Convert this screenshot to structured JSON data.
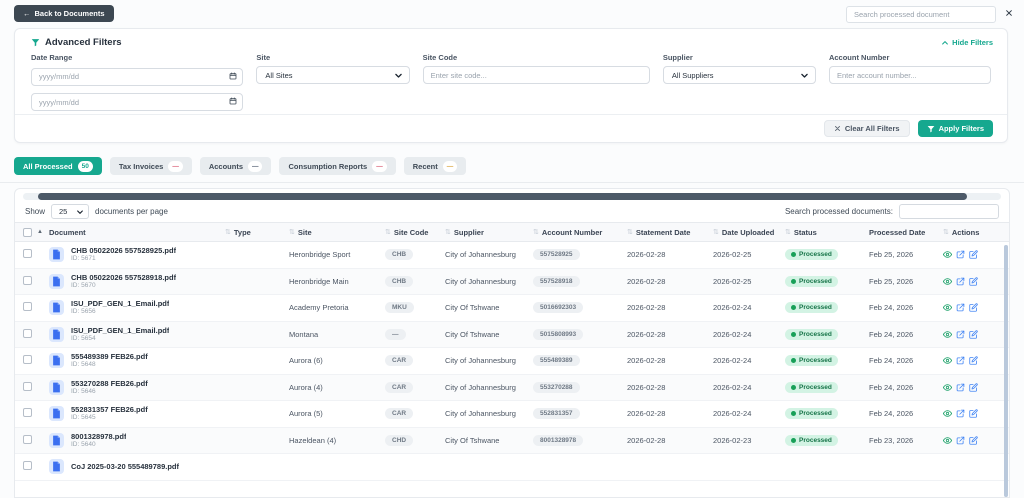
{
  "colors": {
    "accent": "#16a88f",
    "status_green": "#18a058",
    "back_button_bg": "#3d4852"
  },
  "icons": {
    "sort": "⇅",
    "sort_asc": "▲",
    "back_arrow": "←"
  },
  "topbar": {
    "back_label": "Back to Documents",
    "search_placeholder": "Search processed document"
  },
  "filters": {
    "title": "Advanced Filters",
    "hide_label": "Hide Filters",
    "date_range_label": "Date Range",
    "date_placeholder": "yyyy/mm/dd",
    "site_label": "Site",
    "site_value": "All Sites",
    "site_code_label": "Site Code",
    "site_code_placeholder": "Enter site code...",
    "supplier_label": "Supplier",
    "supplier_value": "All Suppliers",
    "account_label": "Account Number",
    "account_placeholder": "Enter account number...",
    "clear_label": "Clear All Filters",
    "apply_label": "Apply Filters"
  },
  "tabs": [
    {
      "label": "All Processed",
      "badge": "50",
      "active": true,
      "badge_color": "#16a88f"
    },
    {
      "label": "Tax Invoices",
      "badge": "—",
      "active": false,
      "badge_color": "#d6526b"
    },
    {
      "label": "Accounts",
      "badge": "—",
      "active": false,
      "badge_color": "#4a5568"
    },
    {
      "label": "Consumption Reports",
      "badge": "—",
      "active": false,
      "badge_color": "#d6526b"
    },
    {
      "label": "Recent",
      "badge": "—",
      "active": false,
      "badge_color": "#d69e2e"
    }
  ],
  "table": {
    "show_label": "Show",
    "per_page": "25",
    "per_page_suffix": "documents per page",
    "search_label": "Search processed documents:",
    "columns": [
      "Document",
      "Type",
      "Site",
      "Site Code",
      "Supplier",
      "Account Number",
      "Statement Date",
      "Date Uploaded",
      "Status",
      "Processed Date",
      "Actions"
    ],
    "rows": [
      {
        "name": "CHB 05022026 557528925.pdf",
        "id": "ID: 5671",
        "type": "",
        "site": "Heronbridge Sport",
        "site_code": "CHB",
        "supplier": "City of Johannesburg",
        "account": "557528925",
        "statement_date": "2026-02-28",
        "date_uploaded": "2026-02-25",
        "status": "Processed",
        "processed_date": "Feb 25, 2026"
      },
      {
        "name": "CHB 05022026 557528918.pdf",
        "id": "ID: 5670",
        "type": "",
        "site": "Heronbridge Main",
        "site_code": "CHB",
        "supplier": "City of Johannesburg",
        "account": "557528918",
        "statement_date": "2026-02-28",
        "date_uploaded": "2026-02-25",
        "status": "Processed",
        "processed_date": "Feb 25, 2026"
      },
      {
        "name": "ISU_PDF_GEN_1_Email.pdf",
        "id": "ID: 5656",
        "type": "",
        "site": "Academy Pretoria",
        "site_code": "MKU",
        "supplier": "City Of Tshwane",
        "account": "5016692303",
        "statement_date": "2026-02-28",
        "date_uploaded": "2026-02-24",
        "status": "Processed",
        "processed_date": "Feb 24, 2026"
      },
      {
        "name": "ISU_PDF_GEN_1_Email.pdf",
        "id": "ID: 5654",
        "type": "",
        "site": "Montana",
        "site_code": "—",
        "supplier": "City Of Tshwane",
        "account": "5015808993",
        "statement_date": "2026-02-28",
        "date_uploaded": "2026-02-24",
        "status": "Processed",
        "processed_date": "Feb 24, 2026"
      },
      {
        "name": "555489389 FEB26.pdf",
        "id": "ID: 5648",
        "type": "",
        "site": "Aurora (6)",
        "site_code": "CAR",
        "supplier": "City of Johannesburg",
        "account": "555489389",
        "statement_date": "2026-02-28",
        "date_uploaded": "2026-02-24",
        "status": "Processed",
        "processed_date": "Feb 24, 2026"
      },
      {
        "name": "553270288 FEB26.pdf",
        "id": "ID: 5646",
        "type": "",
        "site": "Aurora (4)",
        "site_code": "CAR",
        "supplier": "City of Johannesburg",
        "account": "553270288",
        "statement_date": "2026-02-28",
        "date_uploaded": "2026-02-24",
        "status": "Processed",
        "processed_date": "Feb 24, 2026"
      },
      {
        "name": "552831357 FEB26.pdf",
        "id": "ID: 5645",
        "type": "",
        "site": "Aurora (5)",
        "site_code": "CAR",
        "supplier": "City of Johannesburg",
        "account": "552831357",
        "statement_date": "2026-02-28",
        "date_uploaded": "2026-02-24",
        "status": "Processed",
        "processed_date": "Feb 24, 2026"
      },
      {
        "name": "8001328978.pdf",
        "id": "ID: 5640",
        "type": "",
        "site": "Hazeldean (4)",
        "site_code": "CHD",
        "supplier": "City Of Tshwane",
        "account": "8001328978",
        "statement_date": "2026-02-28",
        "date_uploaded": "2026-02-23",
        "status": "Processed",
        "processed_date": "Feb 23, 2026"
      },
      {
        "name": "CoJ 2025-03-20 555489789.pdf",
        "id": "",
        "type": "",
        "site": "",
        "site_code": "",
        "supplier": "",
        "account": "",
        "statement_date": "",
        "date_uploaded": "",
        "status": "",
        "processed_date": "",
        "partial": true
      }
    ]
  }
}
